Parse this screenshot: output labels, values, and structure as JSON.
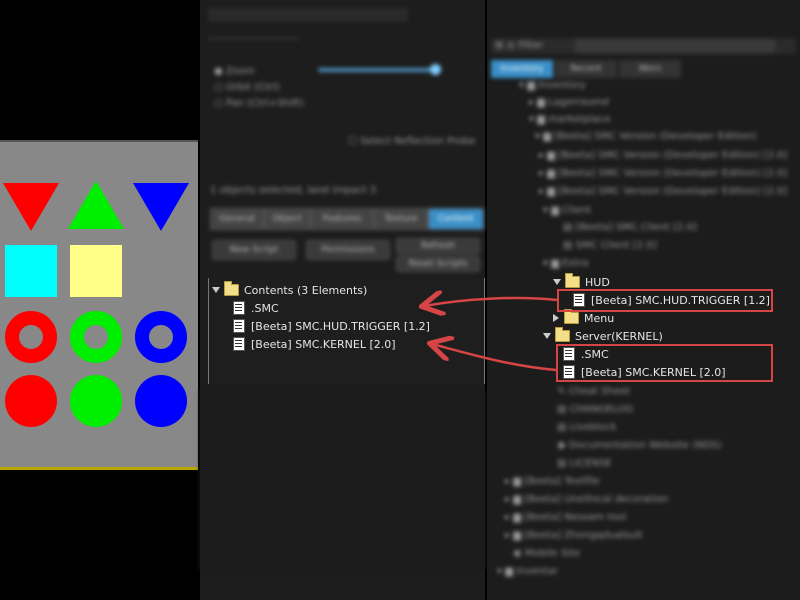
{
  "texture_panel": {
    "shapes": [
      {
        "name": "red-triangle-down-icon",
        "color": "#ff0000"
      },
      {
        "name": "green-triangle-up-icon",
        "color": "#00ee00"
      },
      {
        "name": "blue-triangle-down-icon",
        "color": "#0000ff"
      },
      {
        "name": "cyan-square-icon",
        "color": "#00ffff"
      },
      {
        "name": "yellow-square-icon",
        "color": "#ffff88"
      },
      {
        "name": "red-ring-icon",
        "color": "#ff0000"
      },
      {
        "name": "green-ring-icon",
        "color": "#00ee00"
      },
      {
        "name": "blue-ring-icon",
        "color": "#0000ff"
      },
      {
        "name": "red-circle-icon",
        "color": "#ff0000"
      },
      {
        "name": "green-circle-icon",
        "color": "#00ee00"
      },
      {
        "name": "blue-circle-icon",
        "color": "#0000ff"
      }
    ]
  },
  "build": {
    "radio_options": [
      "Zoom",
      "Orbit (Ctrl)",
      "Pan (Ctrl+Shift)"
    ],
    "checkbox_label": "Select Reflection Probe",
    "selection_status": "1 objects selected, land impact 3",
    "tabs": [
      "General",
      "Object",
      "Features",
      "Texture",
      "Content"
    ],
    "buttons": [
      "New Script",
      "Permissions",
      "Refresh",
      "Reset Scripts"
    ],
    "contents": {
      "header": "Contents (3 Elements)",
      "items": [
        ".SMC",
        "[Beeta] SMC.HUD.TRIGGER [1.2]",
        "[Beeta] SMC.KERNEL [2.0]"
      ]
    }
  },
  "inventory": {
    "filter_label": "Filter",
    "tabs": [
      "Inventory",
      "Recent",
      "Worn"
    ],
    "tree_blurred_top": [
      "Inventory",
      "Lagerraumd",
      "marketplace",
      "[Beeta] SMC Version (Developer Edition)",
      "[Beeta] SMC Version (Developer Edition) [2.0]",
      "[Beeta] SMC Version (Developer Edition) [2.0]",
      "[Beeta] SMC Version (Developer Edition) [2.0]",
      "Client",
      "[Beeta] SMC.Client [2.0]",
      "SMC Client [2.0]",
      "Extra"
    ],
    "hud_folder": "HUD",
    "hud_item": "[Beeta] SMC.HUD.TRIGGER [1.2]",
    "menu_folder": "Menu",
    "server_folder": "Server(KERNEL)",
    "server_items": [
      ".SMC",
      "[Beeta] SMC.KERNEL [2.0]"
    ],
    "tree_blurred_bottom": [
      "Cheat Sheet",
      "CHANGELOG",
      "Liveblock",
      "Documentation Website (NDS)",
      "LICENSE",
      "[Beeta] Textfile",
      "[Beeta] Unethical decoration",
      "[Beeta] Nessam tool",
      "[Beeta] Zhongqdualsuit",
      "Mobile Site",
      "Inventar"
    ]
  },
  "colors": {
    "highlight_box": "#d64545",
    "panel_bg": "#1c1c1c",
    "texture_bg": "#888888"
  }
}
